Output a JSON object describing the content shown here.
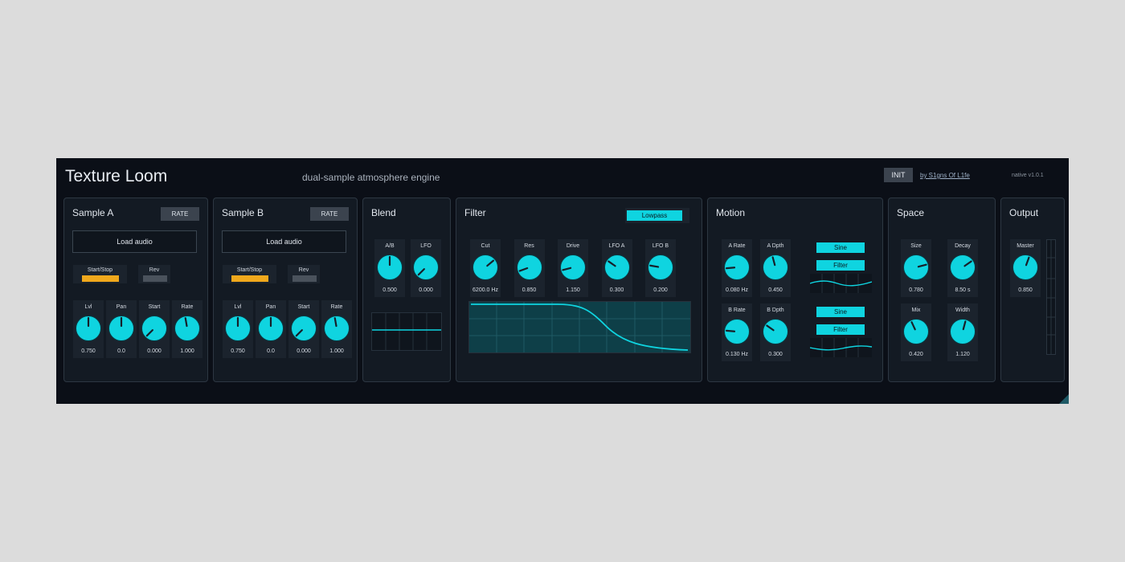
{
  "app": {
    "title": "Texture Loom",
    "subtitle": "dual-sample atmosphere engine",
    "init_label": "INIT",
    "credit": "by S1gns Of L1fe",
    "version": "native v1.0.1"
  },
  "colors": {
    "accent": "#0fd4e0",
    "toggle_on": "#f0a81c",
    "toggle_off": "#4a525c"
  },
  "sample_a": {
    "title": "Sample A",
    "rate_label": "RATE",
    "load_label": "Load audio",
    "start_stop_label": "Start/Stop",
    "rev_label": "Rev",
    "knobs": [
      {
        "label": "Lvl",
        "value": "0.750",
        "angle": 0
      },
      {
        "label": "Pan",
        "value": "0.0",
        "angle": 0
      },
      {
        "label": "Start",
        "value": "0.000",
        "angle": -135
      },
      {
        "label": "Rate",
        "value": "1.000",
        "angle": -10
      }
    ]
  },
  "sample_b": {
    "title": "Sample B",
    "rate_label": "RATE",
    "load_label": "Load audio",
    "start_stop_label": "Start/Stop",
    "rev_label": "Rev",
    "knobs": [
      {
        "label": "Lvl",
        "value": "0.750",
        "angle": 0
      },
      {
        "label": "Pan",
        "value": "0.0",
        "angle": 0
      },
      {
        "label": "Start",
        "value": "0.000",
        "angle": -135
      },
      {
        "label": "Rate",
        "value": "1.000",
        "angle": -10
      }
    ]
  },
  "blend": {
    "title": "Blend",
    "knobs": [
      {
        "label": "A/B",
        "value": "0.500",
        "angle": 0
      },
      {
        "label": "LFO",
        "value": "0.000",
        "angle": -135
      }
    ]
  },
  "filter": {
    "title": "Filter",
    "mode_label": "Lowpass",
    "knobs": [
      {
        "label": "Cut",
        "value": "6200.0 Hz",
        "angle": 50
      },
      {
        "label": "Res",
        "value": "0.850",
        "angle": -110
      },
      {
        "label": "Drive",
        "value": "1.150",
        "angle": -105
      },
      {
        "label": "LFO A",
        "value": "0.300",
        "angle": -55
      },
      {
        "label": "LFO B",
        "value": "0.200",
        "angle": -80
      }
    ]
  },
  "motion": {
    "title": "Motion",
    "knobs": [
      {
        "label": "A Rate",
        "value": "0.080 Hz",
        "angle": -95
      },
      {
        "label": "A Dpth",
        "value": "0.450",
        "angle": -15
      },
      {
        "label": "B Rate",
        "value": "0.130 Hz",
        "angle": -85
      },
      {
        "label": "B Dpth",
        "value": "0.300",
        "angle": -55
      }
    ],
    "lfo_a": {
      "shape_label": "Sine",
      "target_label": "Filter"
    },
    "lfo_b": {
      "shape_label": "Sine",
      "target_label": "Filter"
    }
  },
  "space": {
    "title": "Space",
    "knobs": [
      {
        "label": "Size",
        "value": "0.780",
        "angle": 75
      },
      {
        "label": "Decay",
        "value": "8.50 s",
        "angle": 55
      },
      {
        "label": "Mix",
        "value": "0.420",
        "angle": -25
      },
      {
        "label": "Width",
        "value": "1.120",
        "angle": 15
      }
    ]
  },
  "output": {
    "title": "Output",
    "knobs": [
      {
        "label": "Master",
        "value": "0.850",
        "angle": 20
      }
    ]
  }
}
